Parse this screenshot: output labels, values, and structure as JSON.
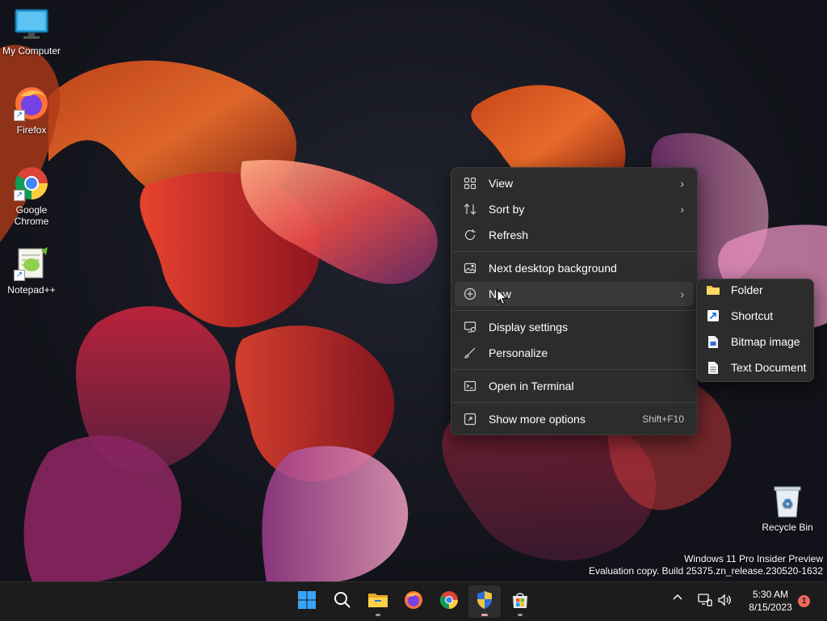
{
  "desktop": {
    "icons": [
      {
        "label": "My Computer",
        "icon": "monitor-icon"
      },
      {
        "label": "Firefox",
        "icon": "firefox-icon"
      },
      {
        "label": "Google Chrome",
        "icon": "chrome-icon"
      },
      {
        "label": "Notepad++",
        "icon": "notepadpp-icon"
      },
      {
        "label": "Recycle Bin",
        "icon": "recycle-bin-icon"
      }
    ]
  },
  "context_menu": {
    "items": [
      {
        "label": "View",
        "icon": "grid-icon",
        "has_submenu": true
      },
      {
        "label": "Sort by",
        "icon": "sort-icon",
        "has_submenu": true
      },
      {
        "label": "Refresh",
        "icon": "refresh-icon",
        "has_submenu": false
      },
      {
        "label": "Next desktop background",
        "icon": "image-swap-icon",
        "has_submenu": false
      },
      {
        "label": "New",
        "icon": "plus-circle-icon",
        "has_submenu": true
      },
      {
        "label": "Display settings",
        "icon": "display-settings-icon",
        "has_submenu": false
      },
      {
        "label": "Personalize",
        "icon": "brush-icon",
        "has_submenu": false
      },
      {
        "label": "Open in Terminal",
        "icon": "terminal-icon",
        "has_submenu": false
      },
      {
        "label": "Show more options",
        "icon": "more-options-icon",
        "has_submenu": false,
        "shortcut": "Shift+F10"
      }
    ],
    "chevron": "›"
  },
  "new_submenu": {
    "items": [
      {
        "label": "Folder",
        "icon": "folder-icon"
      },
      {
        "label": "Shortcut",
        "icon": "shortcut-icon"
      },
      {
        "label": "Bitmap image",
        "icon": "bitmap-icon"
      },
      {
        "label": "Text Document",
        "icon": "text-document-icon"
      }
    ]
  },
  "watermark": {
    "line1": "Windows 11 Pro Insider Preview",
    "line2": "Evaluation copy. Build 25375.zn_release.230520-1632"
  },
  "taskbar": {
    "apps": [
      {
        "name": "start",
        "icon": "windows-start-icon"
      },
      {
        "name": "search",
        "icon": "search-icon"
      },
      {
        "name": "file-explorer",
        "icon": "folder-icon"
      },
      {
        "name": "firefox",
        "icon": "firefox-icon"
      },
      {
        "name": "chrome",
        "icon": "chrome-icon"
      },
      {
        "name": "security",
        "icon": "shield-icon"
      },
      {
        "name": "store",
        "icon": "store-icon"
      }
    ],
    "tray": {
      "chevron": "^",
      "time": "5:30 AM",
      "date": "8/15/2023",
      "notification_count": "1"
    }
  },
  "colors": {
    "menu_bg": "#2c2c2c",
    "taskbar_bg": "#1c1c1c",
    "accent_blue": "#0078d4",
    "notification_badge": "#f0695a"
  }
}
